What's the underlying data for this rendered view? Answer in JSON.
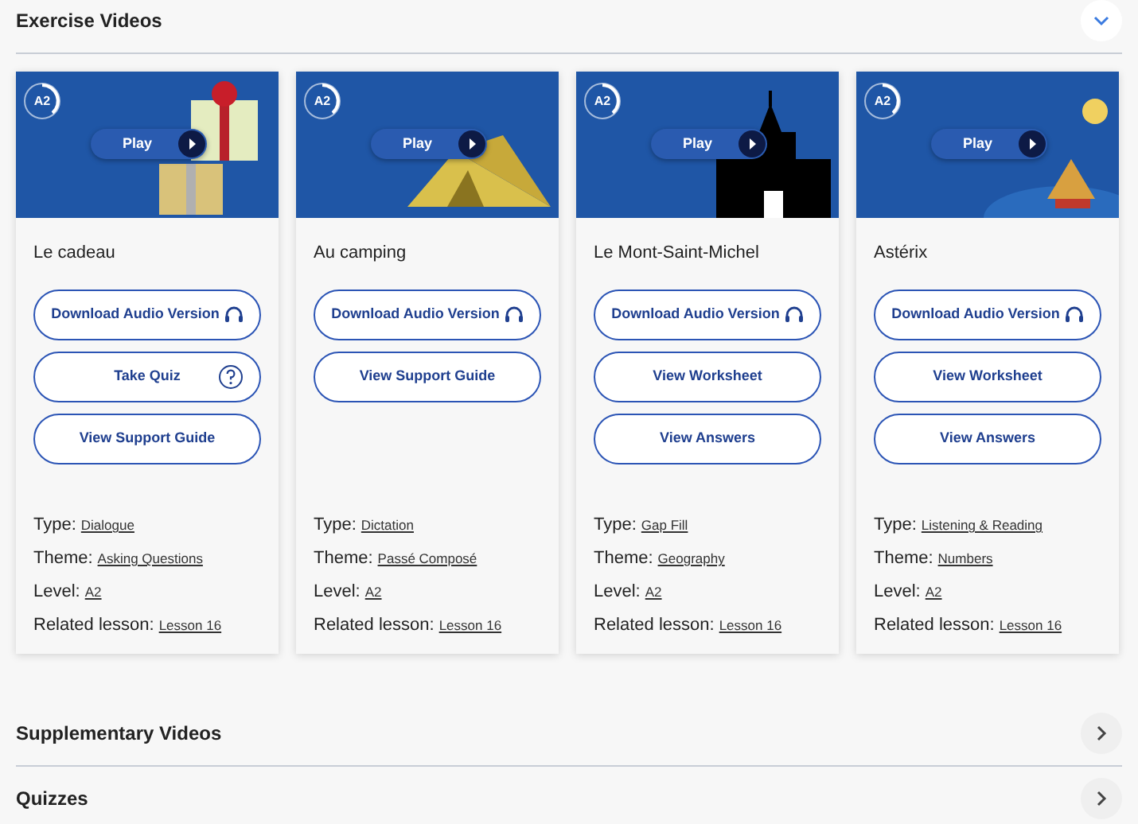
{
  "sections": [
    {
      "title": "Exercise Videos",
      "expanded": true,
      "cards": [
        {
          "level_badge": "A2",
          "play": "Play",
          "thumbnail": {
            "kind": "picture"
          },
          "title": "Le cadeau",
          "buttons": [
            {
              "kind": "audio",
              "label": "Download Audio Version"
            },
            {
              "kind": "quiz",
              "label": "Take Quiz"
            },
            {
              "kind": "plain",
              "label": "View Support Guide"
            }
          ],
          "meta": [
            {
              "label": "Type:",
              "value": "Dialogue"
            },
            {
              "label": "Theme:",
              "value": "Asking Questions"
            },
            {
              "label": "Level:",
              "value": "A2"
            },
            {
              "label": "Related lesson:",
              "value": "Lesson 16"
            }
          ]
        },
        {
          "level_badge": "A2",
          "play": "Play",
          "thumbnail": {
            "kind": "picture"
          },
          "title": "Au camping",
          "buttons": [
            {
              "kind": "audio",
              "label": "Download Audio Version"
            },
            {
              "kind": "plain",
              "label": "View Support Guide"
            }
          ],
          "meta": [
            {
              "label": "Type:",
              "value": "Dictation"
            },
            {
              "label": "Theme:",
              "value": "Passé Composé"
            },
            {
              "label": "Level:",
              "value": "A2"
            },
            {
              "label": "Related lesson:",
              "value": "Lesson 16"
            }
          ]
        },
        {
          "level_badge": "A2",
          "play": "Play",
          "thumbnail": {
            "kind": "picture"
          },
          "title": "Le Mont-Saint-Michel",
          "buttons": [
            {
              "kind": "audio",
              "label": "Download Audio Version"
            },
            {
              "kind": "plain",
              "label": "View Worksheet"
            },
            {
              "kind": "plain",
              "label": "View Answers"
            }
          ],
          "meta": [
            {
              "label": "Type:",
              "value": "Gap Fill"
            },
            {
              "label": "Theme:",
              "value": "Geography"
            },
            {
              "label": "Level:",
              "value": "A2"
            },
            {
              "label": "Related lesson:",
              "value": "Lesson 16"
            }
          ]
        },
        {
          "level_badge": "A2",
          "play": "Play",
          "thumbnail": {
            "kind": "picture"
          },
          "title": "Astérix",
          "buttons": [
            {
              "kind": "audio",
              "label": "Download Audio Version"
            },
            {
              "kind": "plain",
              "label": "View Worksheet"
            },
            {
              "kind": "plain",
              "label": "View Answers"
            }
          ],
          "meta": [
            {
              "label": "Type:",
              "value": "Listening & Reading"
            },
            {
              "label": "Theme:",
              "value": "Numbers"
            },
            {
              "label": "Level:",
              "value": "A2"
            },
            {
              "label": "Related lesson:",
              "value": "Lesson 16"
            }
          ]
        }
      ]
    },
    {
      "title": "Supplementary Videos",
      "expanded": false
    },
    {
      "title": "Quizzes",
      "expanded": false
    }
  ]
}
